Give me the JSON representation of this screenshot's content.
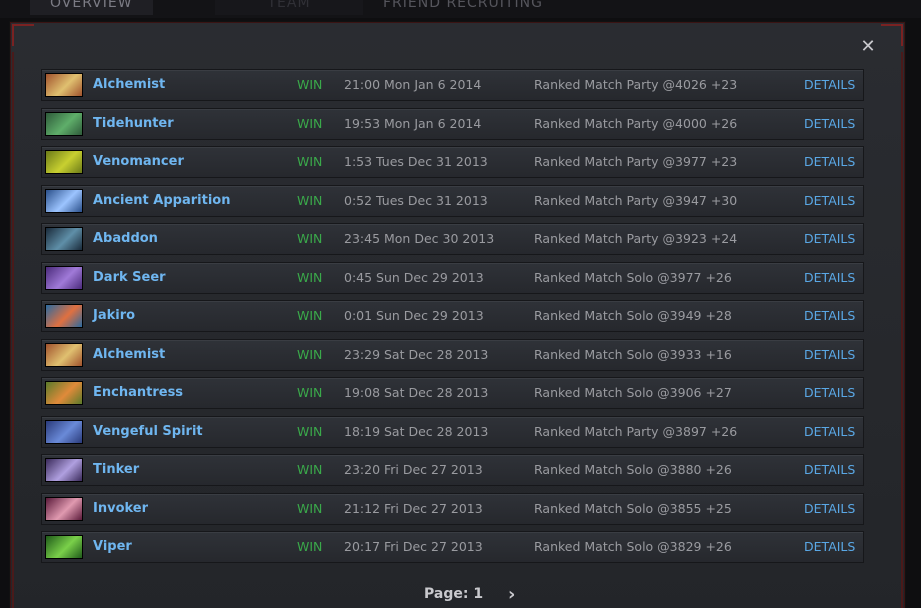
{
  "top_tabs": [
    "OVERVIEW",
    "TEAM",
    "FRIEND RECRUITING"
  ],
  "close_glyph": "✕",
  "matches": [
    {
      "hero": "Alchemist",
      "result": "WIN",
      "when": "21:00 Mon Jan 6 2014",
      "match": "Ranked Match Party @4026 +23",
      "details": "DETAILS",
      "portrait_colors": [
        "#a0522d",
        "#e0c070"
      ]
    },
    {
      "hero": "Tidehunter",
      "result": "WIN",
      "when": "19:53 Mon Jan 6 2014",
      "match": "Ranked Match Party @4000 +26",
      "details": "DETAILS",
      "portrait_colors": [
        "#2e5a3a",
        "#5fae6a"
      ]
    },
    {
      "hero": "Venomancer",
      "result": "WIN",
      "when": "1:53 Tues Dec 31 2013",
      "match": "Ranked Match Party @3977 +23",
      "details": "DETAILS",
      "portrait_colors": [
        "#6b7a18",
        "#c8d030"
      ]
    },
    {
      "hero": "Ancient Apparition",
      "result": "WIN",
      "when": "0:52 Tues Dec 31 2013",
      "match": "Ranked Match Party @3947 +30",
      "details": "DETAILS",
      "portrait_colors": [
        "#2a4f8a",
        "#9cc4ff"
      ]
    },
    {
      "hero": "Abaddon",
      "result": "WIN",
      "when": "23:45 Mon Dec 30 2013",
      "match": "Ranked Match Party @3923 +24",
      "details": "DETAILS",
      "portrait_colors": [
        "#1a2a3a",
        "#5f8fa8"
      ]
    },
    {
      "hero": "Dark Seer",
      "result": "WIN",
      "when": "0:45 Sun Dec 29 2013",
      "match": "Ranked Match Solo @3977 +26",
      "details": "DETAILS",
      "portrait_colors": [
        "#4a2a7a",
        "#a07ad8"
      ]
    },
    {
      "hero": "Jakiro",
      "result": "WIN",
      "when": "0:01 Sun Dec 29 2013",
      "match": "Ranked Match Solo @3949 +28",
      "details": "DETAILS",
      "portrait_colors": [
        "#2a6aa0",
        "#e07040"
      ]
    },
    {
      "hero": "Alchemist",
      "result": "WIN",
      "when": "23:29 Sat Dec 28 2013",
      "match": "Ranked Match Solo @3933 +16",
      "details": "DETAILS",
      "portrait_colors": [
        "#a0522d",
        "#e0c070"
      ]
    },
    {
      "hero": "Enchantress",
      "result": "WIN",
      "when": "19:08 Sat Dec 28 2013",
      "match": "Ranked Match Solo @3906 +27",
      "details": "DETAILS",
      "portrait_colors": [
        "#5a7a2a",
        "#e08a3a"
      ]
    },
    {
      "hero": "Vengeful Spirit",
      "result": "WIN",
      "when": "18:19 Sat Dec 28 2013",
      "match": "Ranked Match Party @3897 +26",
      "details": "DETAILS",
      "portrait_colors": [
        "#2a3a7a",
        "#6a8ad8"
      ]
    },
    {
      "hero": "Tinker",
      "result": "WIN",
      "when": "23:20 Fri Dec 27 2013",
      "match": "Ranked Match Solo @3880 +26",
      "details": "DETAILS",
      "portrait_colors": [
        "#3a2a5a",
        "#b0a0e0"
      ]
    },
    {
      "hero": "Invoker",
      "result": "WIN",
      "when": "21:12 Fri Dec 27 2013",
      "match": "Ranked Match Solo @3855 +25",
      "details": "DETAILS",
      "portrait_colors": [
        "#5a1a3a",
        "#e09ab0"
      ]
    },
    {
      "hero": "Viper",
      "result": "WIN",
      "when": "20:17 Fri Dec 27 2013",
      "match": "Ranked Match Solo @3829 +26",
      "details": "DETAILS",
      "portrait_colors": [
        "#1f5a1a",
        "#7ad04a"
      ]
    }
  ],
  "pager": {
    "label": "Page: 1",
    "next_glyph": "›"
  },
  "colors": {
    "hero": "#6fb6f0",
    "win": "#3aa94a",
    "details": "#5aa8e6",
    "text": "#9a9ba0",
    "modal_accent": "#7a2222"
  }
}
